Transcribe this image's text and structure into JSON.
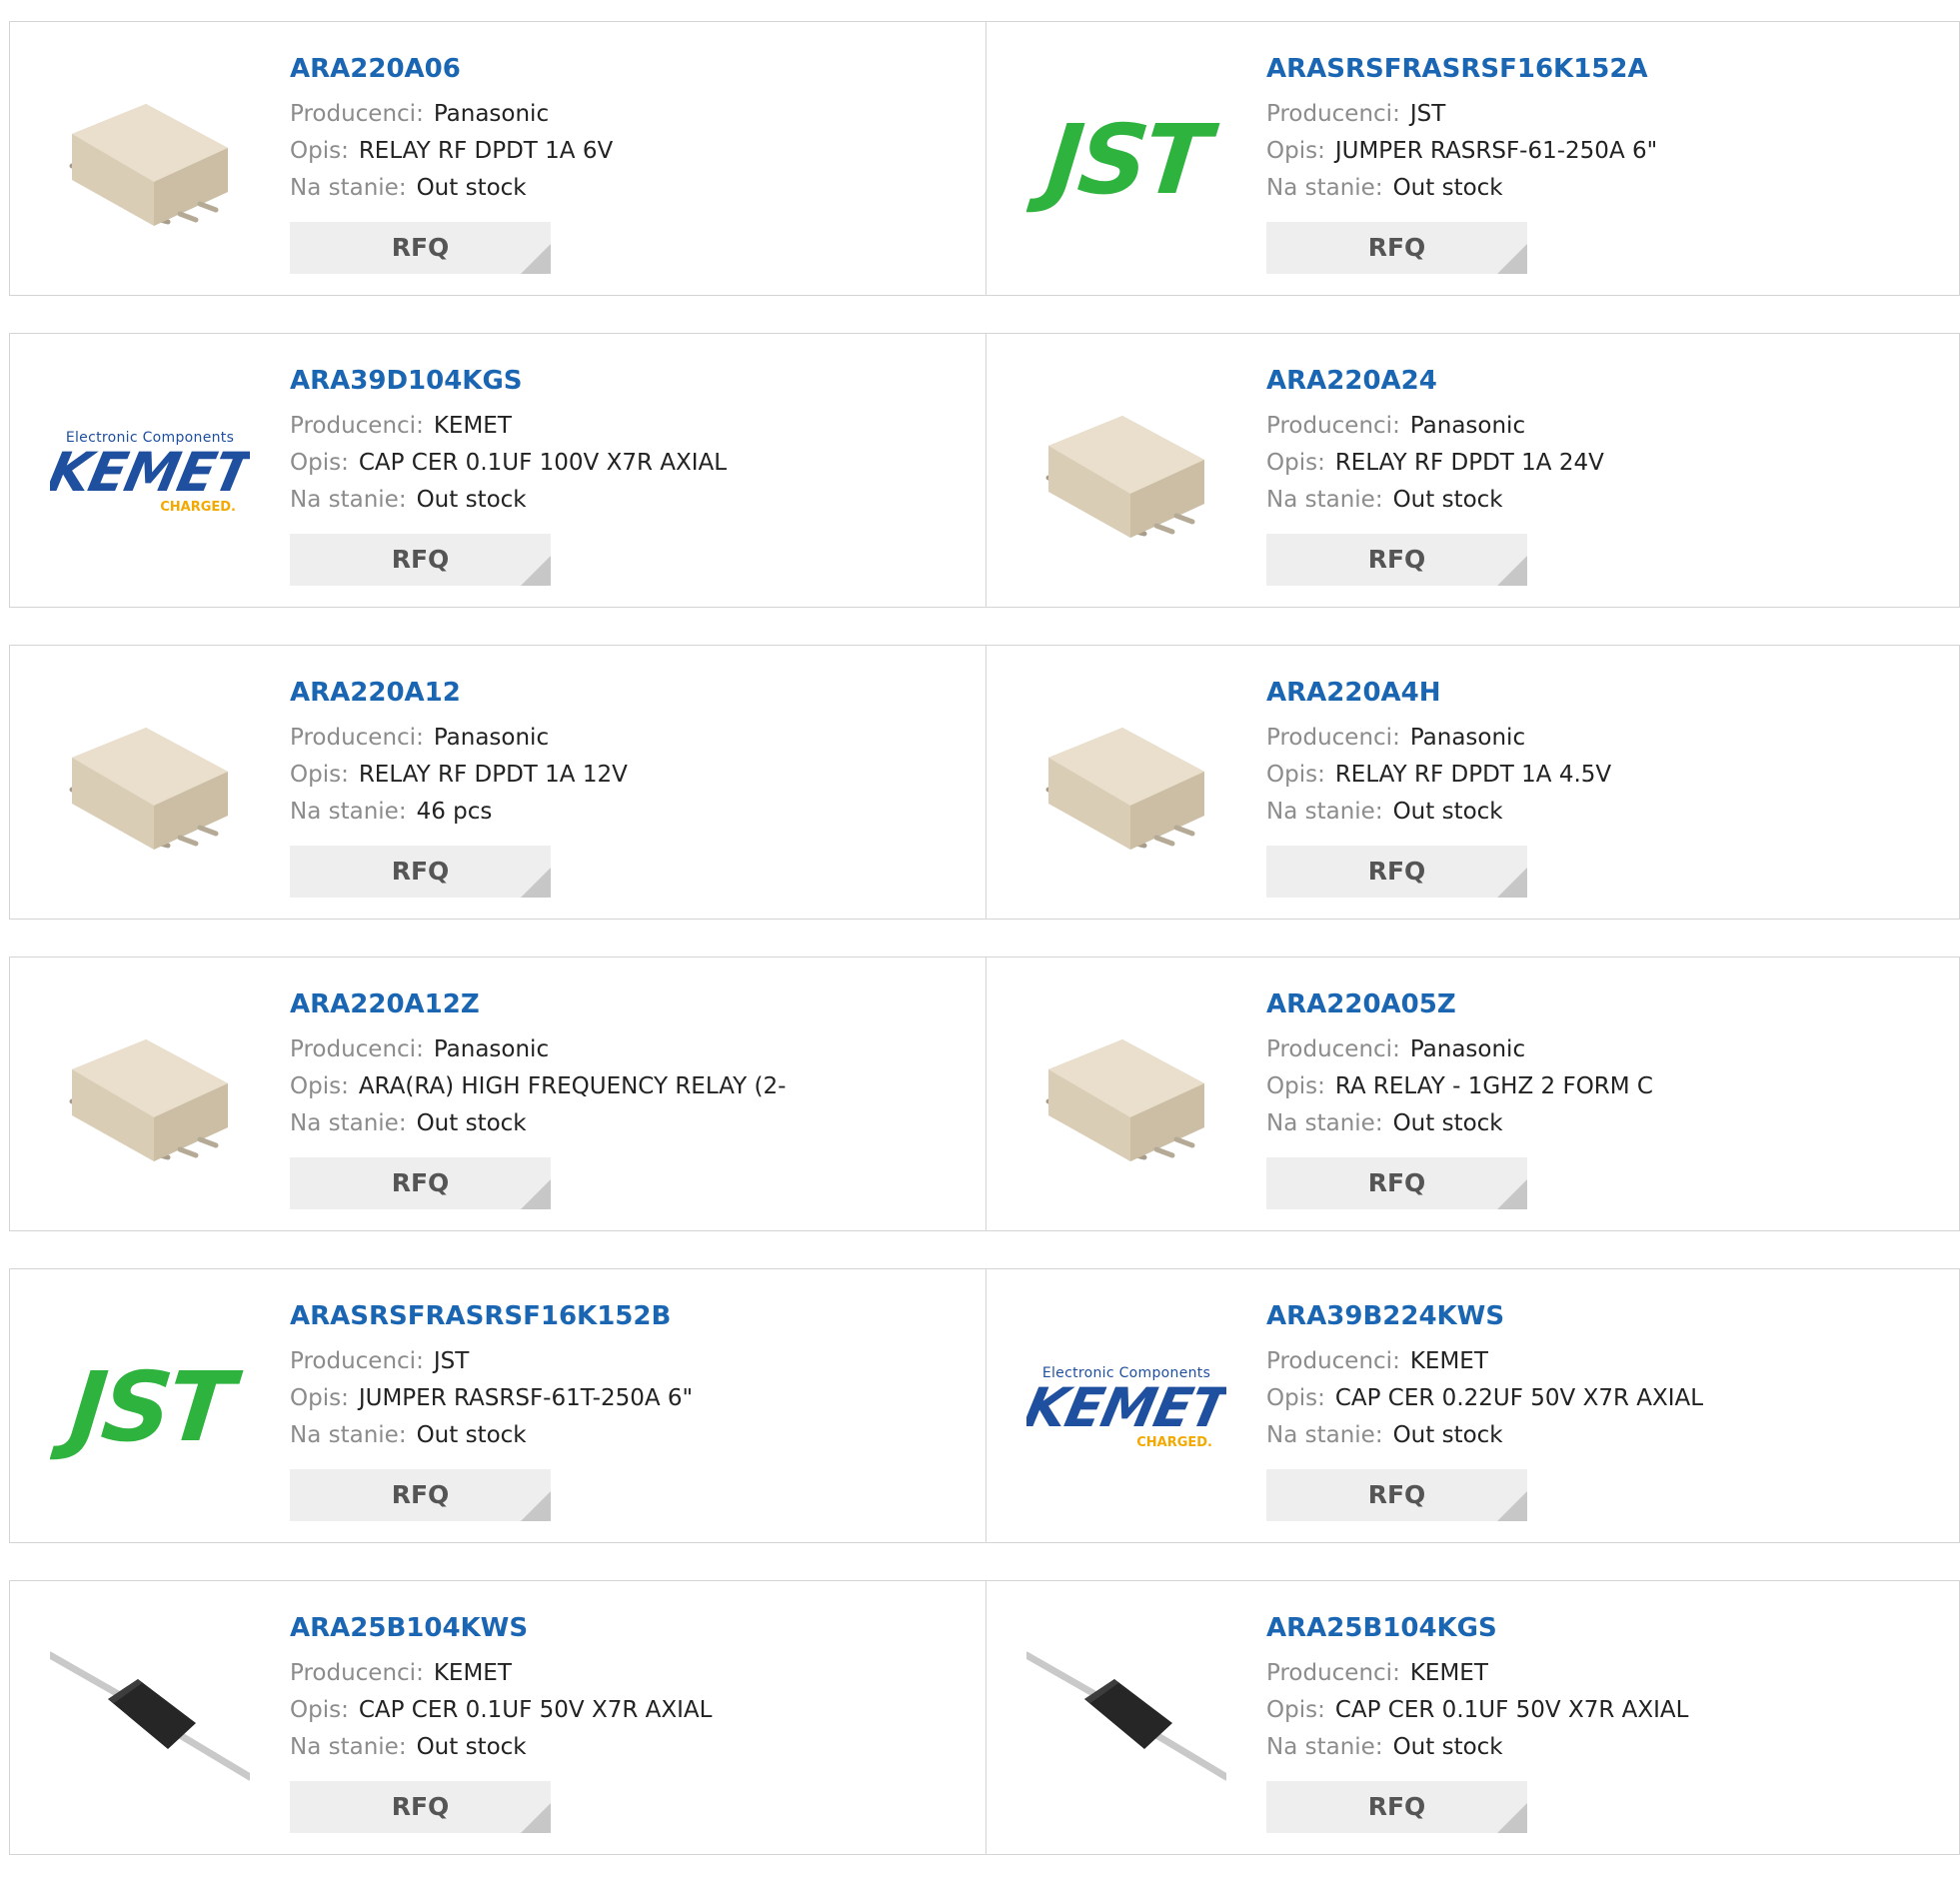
{
  "labels": {
    "manufacturer": "Producenci:",
    "description": "Opis:",
    "stock": "Na stanie:",
    "rfq": "RFQ"
  },
  "kemet_logo": {
    "top": "Electronic Components",
    "main": "KEMET",
    "sub": "CHARGED."
  },
  "jst_logo": {
    "text": "JST"
  },
  "products": [
    {
      "part": "ARA220A06",
      "manufacturer": "Panasonic",
      "description": "RELAY RF DPDT 1A 6V",
      "stock": "Out stock",
      "image": "relay-icon"
    },
    {
      "part": "ARASRSFRASRSF16K152A",
      "manufacturer": "JST",
      "description": "JUMPER RASRSF-61-250A 6\"",
      "stock": "Out stock",
      "image": "jst-logo"
    },
    {
      "part": "ARA39D104KGS",
      "manufacturer": "KEMET",
      "description": "CAP CER 0.1UF 100V X7R AXIAL",
      "stock": "Out stock",
      "image": "kemet-logo"
    },
    {
      "part": "ARA220A24",
      "manufacturer": "Panasonic",
      "description": "RELAY RF DPDT 1A 24V",
      "stock": "Out stock",
      "image": "relay-icon"
    },
    {
      "part": "ARA220A12",
      "manufacturer": "Panasonic",
      "description": "RELAY RF DPDT 1A 12V",
      "stock": "46 pcs",
      "image": "relay-icon"
    },
    {
      "part": "ARA220A4H",
      "manufacturer": "Panasonic",
      "description": "RELAY RF DPDT 1A 4.5V",
      "stock": "Out stock",
      "image": "relay-icon"
    },
    {
      "part": "ARA220A12Z",
      "manufacturer": "Panasonic",
      "description": "ARA(RA) HIGH FREQUENCY RELAY (2-",
      "stock": "Out stock",
      "image": "relay-icon"
    },
    {
      "part": "ARA220A05Z",
      "manufacturer": "Panasonic",
      "description": "RA RELAY - 1GHZ 2 FORM C",
      "stock": "Out stock",
      "image": "relay-icon"
    },
    {
      "part": "ARASRSFRASRSF16K152B",
      "manufacturer": "JST",
      "description": "JUMPER RASRSF-61T-250A 6\"",
      "stock": "Out stock",
      "image": "jst-logo"
    },
    {
      "part": "ARA39B224KWS",
      "manufacturer": "KEMET",
      "description": "CAP CER 0.22UF 50V X7R AXIAL",
      "stock": "Out stock",
      "image": "kemet-logo"
    },
    {
      "part": "ARA25B104KWS",
      "manufacturer": "KEMET",
      "description": "CAP CER 0.1UF 50V X7R AXIAL",
      "stock": "Out stock",
      "image": "capacitor-icon"
    },
    {
      "part": "ARA25B104KGS",
      "manufacturer": "KEMET",
      "description": "CAP CER 0.1UF 50V X7R AXIAL",
      "stock": "Out stock",
      "image": "capacitor-icon"
    }
  ]
}
